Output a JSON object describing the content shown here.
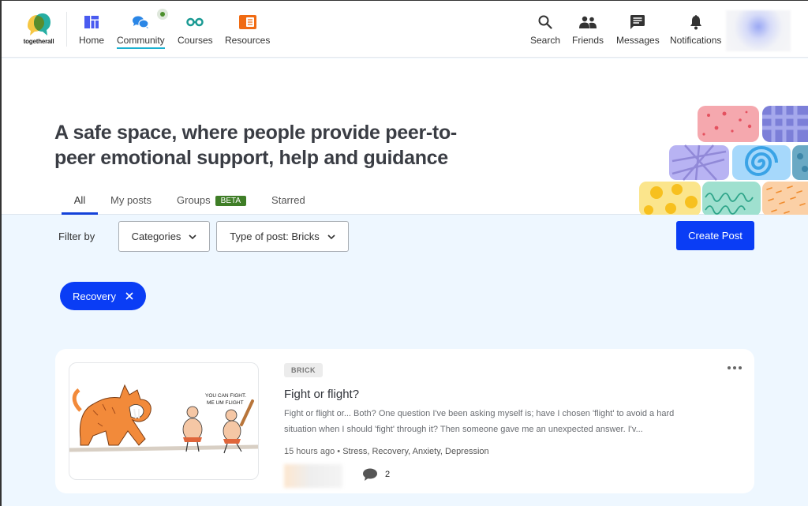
{
  "brand": {
    "name": "togetherall"
  },
  "nav": {
    "left": [
      {
        "label": "Home",
        "icon": "home-grid-icon",
        "color": "#4a5bf0"
      },
      {
        "label": "Community",
        "icon": "chat-bubbles-icon",
        "color": "#2a86e6",
        "active": true,
        "has_notification_dot": true
      },
      {
        "label": "Courses",
        "icon": "glasses-icon",
        "color": "#1a9a93"
      },
      {
        "label": "Resources",
        "icon": "open-book-icon",
        "color": "#f06a12"
      }
    ],
    "right": [
      {
        "label": "Search",
        "icon": "search-icon"
      },
      {
        "label": "Friends",
        "icon": "friends-icon"
      },
      {
        "label": "Messages",
        "icon": "message-icon"
      },
      {
        "label": "Notifications",
        "icon": "bell-icon"
      }
    ]
  },
  "hero": {
    "title": "A safe space, where people provide peer-to-peer emotional support, help and guidance",
    "tabs": [
      {
        "label": "All",
        "active": true
      },
      {
        "label": "My posts"
      },
      {
        "label": "Groups",
        "badge": "BETA"
      },
      {
        "label": "Starred"
      }
    ]
  },
  "filters": {
    "label": "Filter by",
    "categories": "Categories",
    "type_of_post": "Type of post: Bricks",
    "create_post": "Create Post",
    "active_chips": [
      {
        "label": "Recovery"
      }
    ]
  },
  "posts": [
    {
      "type_tag": "BRICK",
      "title": "Fight or flight?",
      "excerpt": "Fight or flight or... Both? One question I've been asking myself is; have I chosen 'flight' to avoid a hard situation when I should 'fight' through it? Then someone gave me an unexpected answer. I'v...",
      "time": "15 hours ago",
      "categories": "Stress, Recovery, Anxiety, Depression",
      "comment_count": "2",
      "image_caption": "YOU CAN FIGHT. ME UM FLIGHT"
    }
  ],
  "colors": {
    "primary": "#0a3df5",
    "beta": "#3f7e27",
    "active_tab_underline": "#1442d9",
    "nav_active_underline": "#1ab0d0",
    "page_bg": "#eef7ff"
  }
}
